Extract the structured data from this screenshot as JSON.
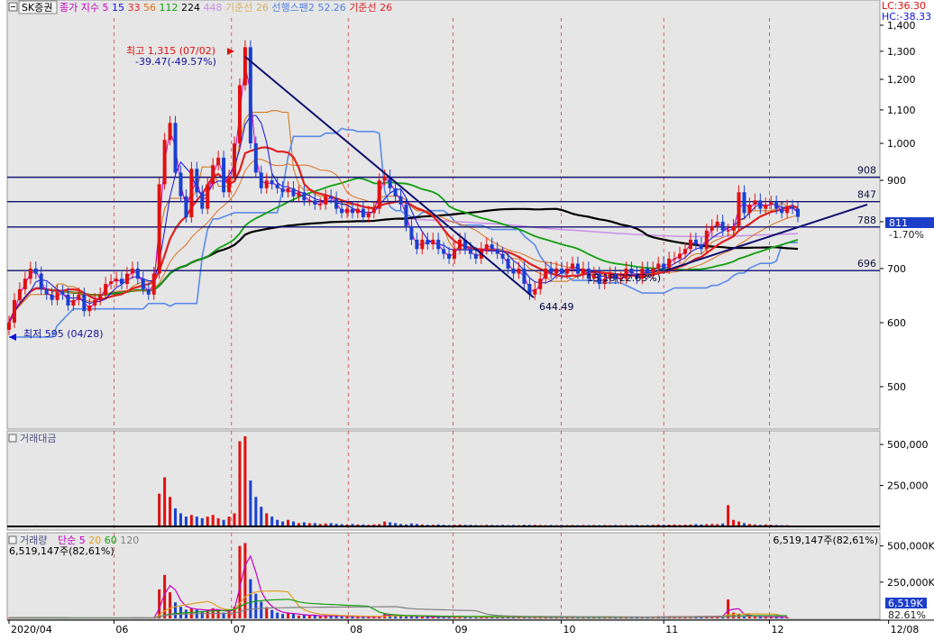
{
  "header": {
    "stock_name": "SK증권",
    "items": [
      {
        "label": "종가 지수",
        "color": "#c000c0"
      },
      {
        "label": "5",
        "color": "#c000c0"
      },
      {
        "label": "15",
        "color": "#1010e0"
      },
      {
        "label": "33",
        "color": "#e02020"
      },
      {
        "label": "56",
        "color": "#e07020"
      },
      {
        "label": "112",
        "color": "#10a010"
      },
      {
        "label": "224",
        "color": "#000000"
      },
      {
        "label": "448",
        "color": "#c890e8"
      },
      {
        "label": "기준선 26",
        "color": "#d8b060"
      },
      {
        "label": "선행스팬2 52.26",
        "color": "#5080e0"
      },
      {
        "label": "기준선 26",
        "color": "#e02020"
      }
    ],
    "lc_text": "LC:36.30",
    "hc_text": "HC:-38.33"
  },
  "chart_data": [
    {
      "type": "candlestick",
      "panel": "price",
      "y_ticks": [
        "1,400",
        "1,300",
        "1,200",
        "1,100",
        "1,000",
        "900",
        "800",
        "700",
        "600",
        "500"
      ],
      "y_tick_values": [
        1400,
        1300,
        1200,
        1100,
        1000,
        900,
        800,
        700,
        600,
        500
      ],
      "ylim": [
        450,
        1400
      ],
      "y_scale": "log",
      "x_ticks": [
        "2020/04",
        "06",
        "07",
        "08",
        "09",
        "10",
        "11",
        "12",
        "12/08"
      ],
      "horizontal_levels": [
        908,
        847,
        788,
        696
      ],
      "horizontal_level_labels": [
        "908",
        "847",
        "788",
        "696"
      ],
      "current_value": "811",
      "current_change": "-1.70%",
      "annotations": {
        "high_label": "최고 1,315 (07/02)",
        "high_change": "-39.47(-49.57%)",
        "low_label": "최저 595 (04/28)",
        "trend_end_label": "644.49",
        "partial_label": "13.18(22.63%)"
      },
      "candles_close": [
        600,
        640,
        660,
        680,
        700,
        690,
        660,
        650,
        640,
        655,
        650,
        630,
        640,
        650,
        620,
        630,
        640,
        650,
        670,
        675,
        680,
        670,
        690,
        700,
        680,
        660,
        650,
        690,
        890,
        1010,
        1060,
        920,
        860,
        810,
        930,
        870,
        830,
        890,
        940,
        960,
        870,
        910,
        1000,
        1180,
        1315,
        1000,
        920,
        880,
        900,
        890,
        880,
        870,
        880,
        860,
        870,
        850,
        850,
        840,
        840,
        860,
        855,
        830,
        820,
        830,
        820,
        830,
        810,
        820,
        830,
        900,
        910,
        880,
        860,
        840,
        790,
        760,
        740,
        760,
        750,
        760,
        740,
        730,
        720,
        740,
        760,
        740,
        730,
        720,
        740,
        750,
        740,
        730,
        720,
        700,
        690,
        700,
        670,
        650,
        660,
        680,
        700,
        690,
        700,
        690,
        700,
        710,
        690,
        700,
        680,
        690,
        670,
        680,
        690,
        680,
        680,
        700,
        690,
        680,
        700,
        690,
        700,
        710,
        700,
        720,
        720,
        730,
        740,
        760,
        750,
        740,
        780,
        790,
        800,
        780,
        780,
        790,
        870,
        820,
        840,
        850,
        830,
        840,
        845,
        830,
        820,
        835,
        830,
        811
      ]
    },
    {
      "type": "bar",
      "panel": "trading_value",
      "title": "거래대금",
      "y_ticks": [
        "500,000",
        "250,000"
      ],
      "y_tick_values": [
        500000,
        250000
      ],
      "values": [
        4,
        3,
        5,
        4,
        3,
        6,
        4,
        3,
        3,
        2,
        3,
        2,
        2,
        3,
        2,
        2,
        3,
        2,
        3,
        2,
        3,
        2,
        3,
        4,
        3,
        2,
        3,
        3,
        200,
        300,
        180,
        110,
        80,
        60,
        70,
        60,
        50,
        60,
        70,
        50,
        40,
        60,
        80,
        520,
        550,
        280,
        180,
        120,
        80,
        60,
        40,
        30,
        40,
        30,
        20,
        25,
        20,
        20,
        15,
        18,
        20,
        16,
        14,
        12,
        15,
        12,
        12,
        10,
        12,
        14,
        30,
        25,
        20,
        15,
        12,
        18,
        15,
        12,
        10,
        10,
        12,
        10,
        8,
        10,
        12,
        10,
        10,
        9,
        8,
        10,
        9,
        8,
        10,
        8,
        9,
        8,
        10,
        9,
        10,
        9,
        8,
        9,
        8,
        9,
        8,
        9,
        8,
        9,
        8,
        9,
        8,
        9,
        8,
        9,
        8,
        9,
        8,
        9,
        8,
        9,
        10,
        12,
        10,
        11,
        12,
        10,
        11,
        12,
        14,
        12,
        14,
        15,
        14,
        18,
        130,
        40,
        30,
        20,
        15,
        12,
        10,
        12,
        10,
        9,
        8,
        8
      ]
    },
    {
      "type": "bar",
      "panel": "volume",
      "title": "거래량",
      "legend": [
        {
          "label": "단순 5",
          "color": "#c000c0"
        },
        {
          "label": "20",
          "color": "#e0a020"
        },
        {
          "label": "60",
          "color": "#10a010"
        },
        {
          "label": "120",
          "color": "#808080"
        }
      ],
      "volume_label": "6,519,147주(82,61%)",
      "y_ticks": [
        "500,000K",
        "250,000K"
      ],
      "y_tick_values": [
        500000,
        250000
      ],
      "current_value": "6,519K",
      "current_pct": "82.61%",
      "values": [
        4,
        3,
        5,
        4,
        3,
        6,
        4,
        3,
        3,
        2,
        3,
        2,
        2,
        3,
        2,
        2,
        3,
        2,
        3,
        2,
        3,
        2,
        3,
        4,
        3,
        2,
        3,
        3,
        200,
        300,
        180,
        110,
        80,
        60,
        70,
        60,
        50,
        60,
        70,
        50,
        40,
        60,
        80,
        500,
        520,
        270,
        170,
        115,
        78,
        58,
        40,
        30,
        40,
        30,
        20,
        25,
        20,
        20,
        15,
        18,
        20,
        16,
        14,
        12,
        15,
        12,
        12,
        10,
        12,
        14,
        30,
        25,
        20,
        15,
        12,
        18,
        15,
        12,
        10,
        10,
        12,
        10,
        8,
        10,
        12,
        10,
        10,
        9,
        8,
        10,
        9,
        8,
        10,
        8,
        9,
        8,
        10,
        9,
        10,
        9,
        8,
        9,
        8,
        9,
        8,
        9,
        8,
        9,
        8,
        9,
        8,
        9,
        8,
        9,
        8,
        9,
        8,
        9,
        8,
        9,
        10,
        12,
        10,
        11,
        12,
        10,
        11,
        12,
        14,
        12,
        14,
        15,
        14,
        18,
        130,
        40,
        30,
        20,
        15,
        12,
        10,
        12,
        10,
        9,
        8,
        8
      ]
    }
  ]
}
